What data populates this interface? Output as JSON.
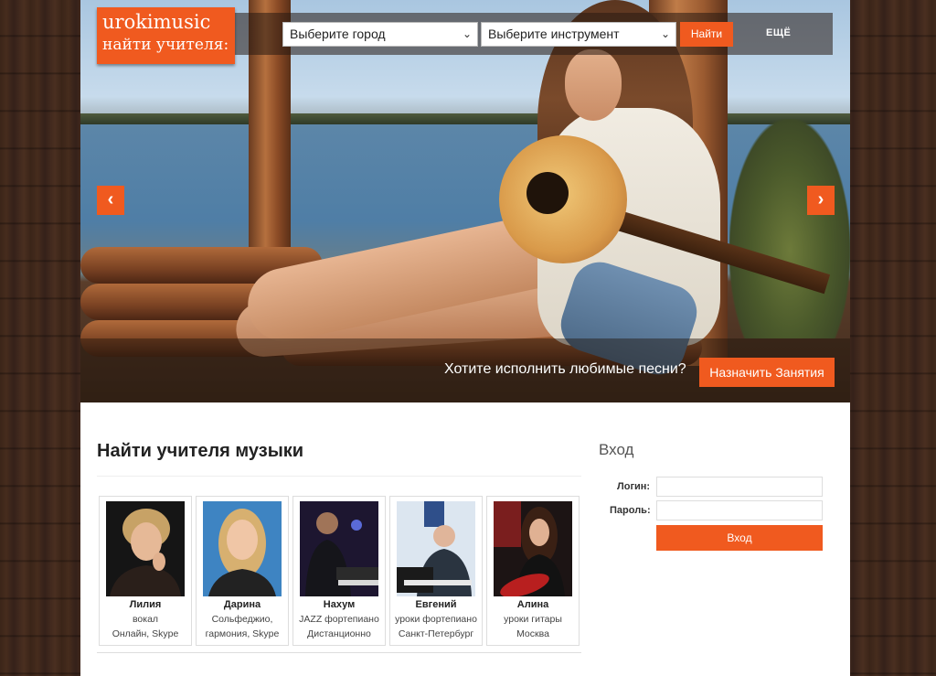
{
  "logo": {
    "line1": "urokimusic",
    "line2": "найти учителя:"
  },
  "header": {
    "city_select": "Выберите город",
    "instrument_select": "Выберите инструмент",
    "find_button": "Найти",
    "more_link": "ЕЩЁ"
  },
  "slider": {
    "prev_icon": "chevron-left-icon",
    "next_icon": "chevron-right-icon",
    "caption": "Хотите исполнить любимые песни?",
    "cta_button": "Назначить Занятия"
  },
  "main": {
    "title": "Найти учителя музыки",
    "teachers": [
      {
        "name": "Лилия",
        "line1": "вокал",
        "line2": "Онлайн, Skype"
      },
      {
        "name": "Дарина",
        "line1": "Сольфеджио,",
        "line2": "гармония, Skype"
      },
      {
        "name": "Нахум",
        "line1": "JAZZ фортепиано",
        "line2": "Дистанционно"
      },
      {
        "name": "Евгений",
        "line1": "уроки фортепиано",
        "line2": "Санкт-Петербург"
      },
      {
        "name": "Алина",
        "line1": "уроки гитары",
        "line2": "Москва"
      }
    ]
  },
  "login": {
    "title": "Вход",
    "login_label": "Логин:",
    "password_label": "Пароль:",
    "submit": "Вход"
  },
  "colors": {
    "accent": "#f05a1f",
    "page_bg": "#3a2418"
  }
}
